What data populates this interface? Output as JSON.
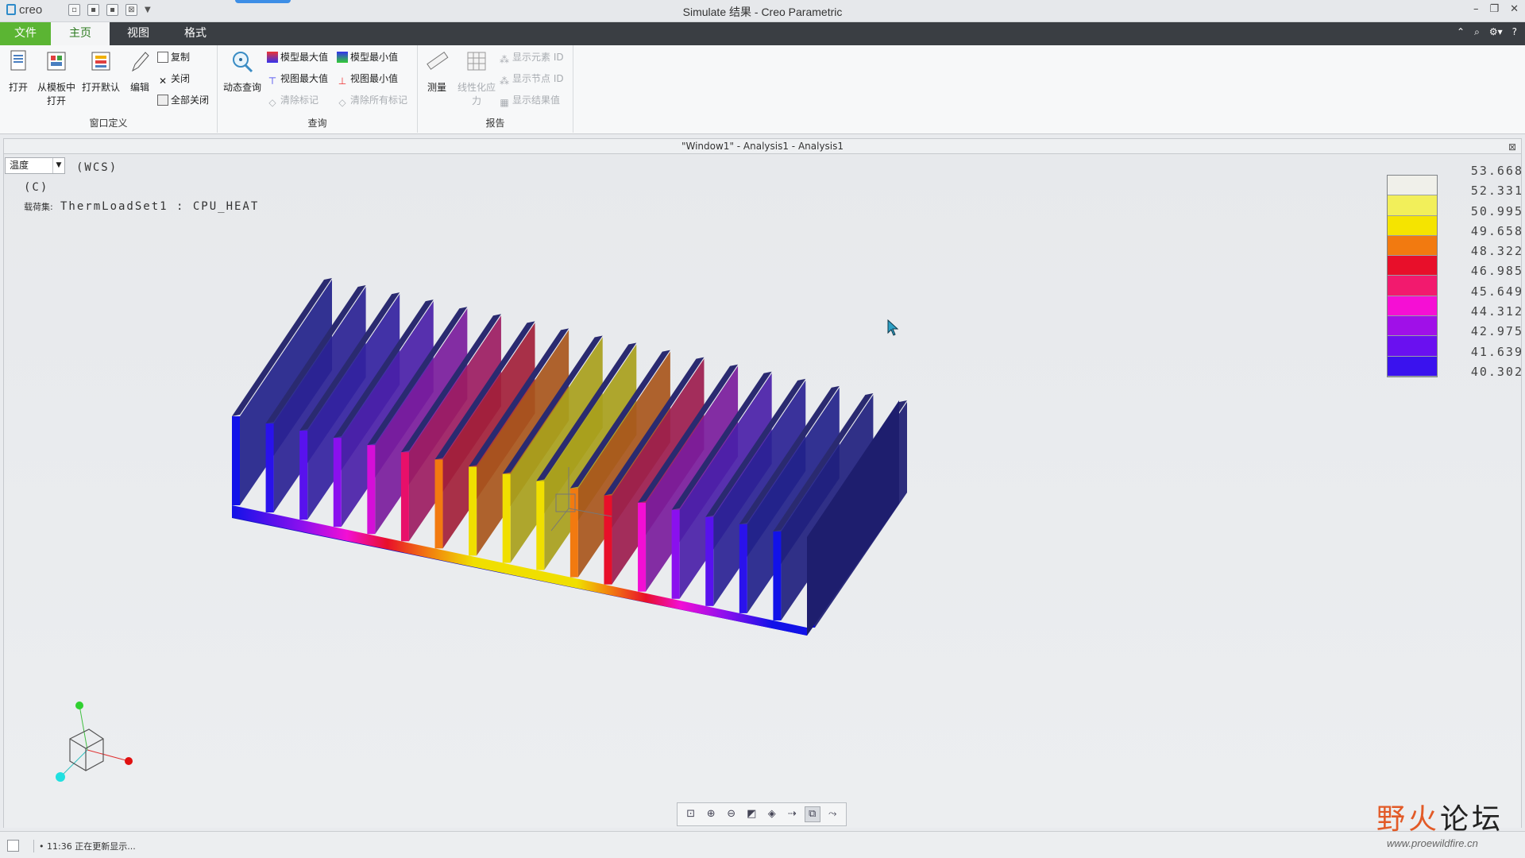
{
  "app": {
    "logo": "creo",
    "window_title": "Simulate 结果 - Creo Parametric"
  },
  "ribbon": {
    "tabs": [
      {
        "label": "文件"
      },
      {
        "label": "主页"
      },
      {
        "label": "视图"
      },
      {
        "label": "格式"
      }
    ],
    "groups": {
      "window_def": {
        "label": "窗口定义",
        "open": "打开",
        "open_template_1": "从模板中",
        "open_template_2": "打开",
        "open_default": "打开默认",
        "edit": "编辑",
        "copy": "复制",
        "close": "关闭",
        "close_all": "全部关闭"
      },
      "query": {
        "label": "查询",
        "dynamic_query": "动态查询",
        "model_max": "模型最大值",
        "model_min": "模型最小值",
        "view_max": "视图最大值",
        "view_min": "视图最小值",
        "clear_marks": "清除标记",
        "clear_all_marks": "清除所有标记"
      },
      "report": {
        "label": "报告",
        "measure": "测量",
        "linearize_1": "线性化应",
        "linearize_2": "力",
        "show_element_id": "显示元素 ID",
        "show_node_id": "显示节点 ID",
        "show_result": "显示结果值"
      }
    }
  },
  "model_window": {
    "title": "\"Window1\" - Analysis1 - Analysis1",
    "quantity": "温度",
    "wcs": "(WCS)",
    "unit": "(C)",
    "load_label": "载荷集:",
    "load_value": "ThermLoadSet1 : CPU_HEAT"
  },
  "legend": {
    "values": [
      "53.668",
      "52.331",
      "50.995",
      "49.658",
      "48.322",
      "46.985",
      "45.649",
      "44.312",
      "42.975",
      "41.639",
      "40.302"
    ],
    "colors": [
      "#f0f0ea",
      "#f2ef5a",
      "#f5e400",
      "#f27a10",
      "#e80f2a",
      "#f21a6e",
      "#f50fd4",
      "#a010e8",
      "#6a10f0",
      "#3a12ee",
      "#0a0af5"
    ]
  },
  "status": {
    "message": "11:36 正在更新显示..."
  },
  "watermark": {
    "text_a": "野火",
    "text_b": "论坛",
    "url": "www.proewildfire.cn"
  }
}
